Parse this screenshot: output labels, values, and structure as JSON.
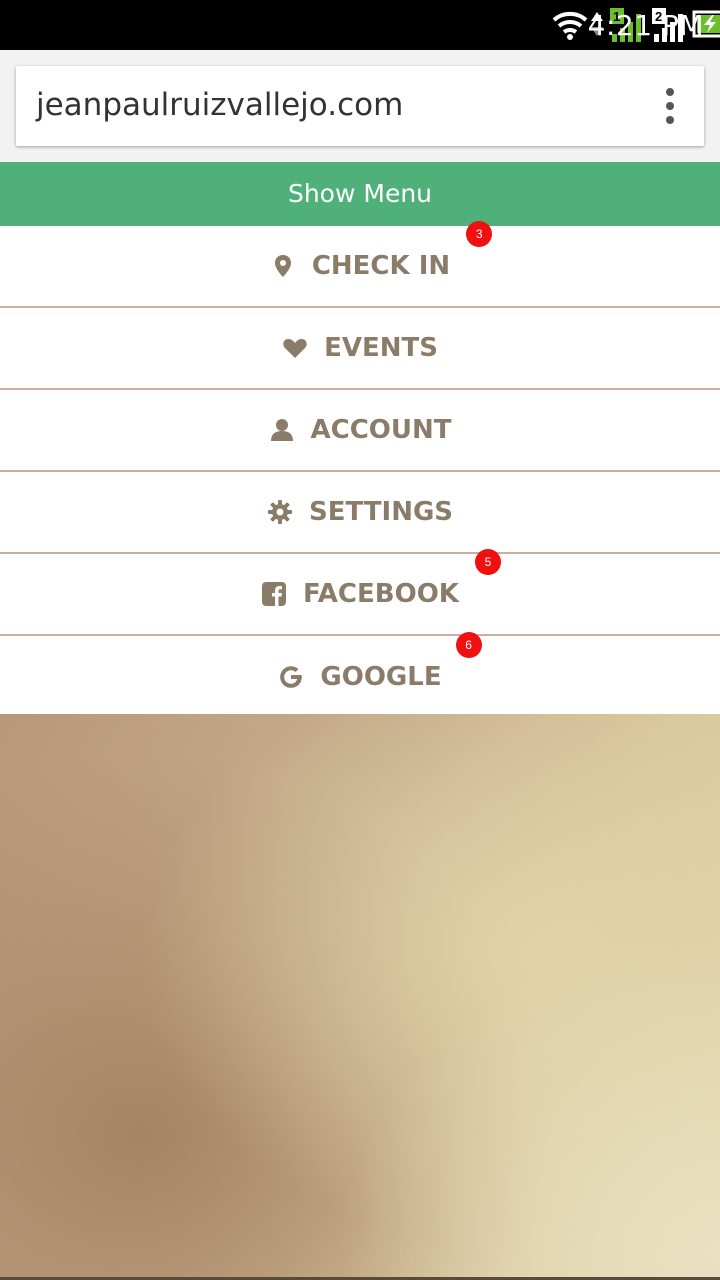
{
  "status_bar": {
    "time": "4:21 PM",
    "sim1_label": "1",
    "sim2_label": "2"
  },
  "browser": {
    "url": "jeanpaulruizvallejo.com"
  },
  "show_menu": {
    "label": "Show Menu",
    "color": "#4fb07a"
  },
  "menu": {
    "items": [
      {
        "label": "CHECK IN",
        "icon": "map-marker-icon",
        "badge": "3"
      },
      {
        "label": "EVENTS",
        "icon": "heart-icon",
        "badge": null
      },
      {
        "label": "ACCOUNT",
        "icon": "user-icon",
        "badge": null
      },
      {
        "label": "SETTINGS",
        "icon": "gear-icon",
        "badge": null
      },
      {
        "label": "FACEBOOK",
        "icon": "facebook-square-icon",
        "badge": "5"
      },
      {
        "label": "GOOGLE",
        "icon": "google-icon",
        "badge": "6"
      }
    ],
    "text_color": "#8b7b69",
    "badge_color": "#f01010"
  }
}
